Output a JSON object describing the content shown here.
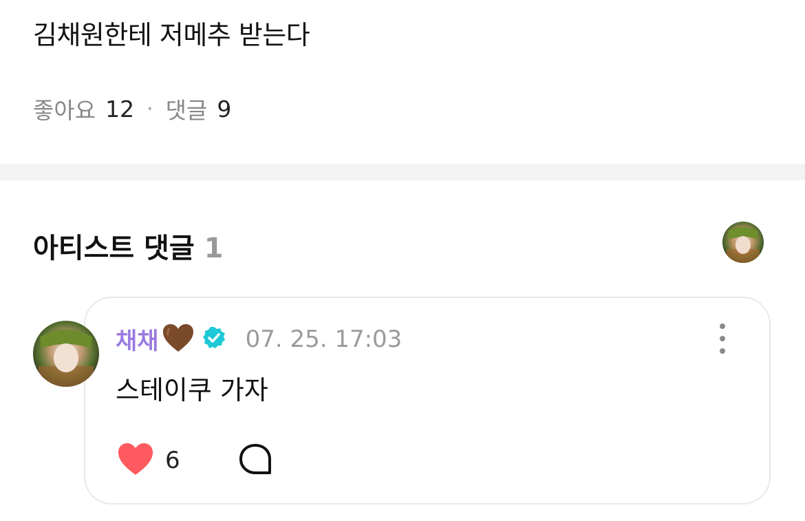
{
  "post": {
    "text": "김채원한테 저메추 받는다"
  },
  "stats": {
    "likes_label": "좋아요",
    "likes_count": "12",
    "separator": "·",
    "comments_label": "댓글",
    "comments_count": "9"
  },
  "artist_comments": {
    "title": "아티스트 댓글",
    "count": "1"
  },
  "comment": {
    "author": "채채",
    "author_emoji": "🤎",
    "timestamp": "07. 25. 17:03",
    "body": "스테이쿠 가자",
    "like_count": "6"
  },
  "colors": {
    "author": "#9b7ae0",
    "verified": "#1ec8d6",
    "like_heart": "#ff5a5f",
    "divider": "#f3f3f3"
  },
  "icons": [
    "brown-heart-icon",
    "verified-badge-icon",
    "more-options-icon",
    "heart-icon",
    "reply-bubble-icon"
  ]
}
